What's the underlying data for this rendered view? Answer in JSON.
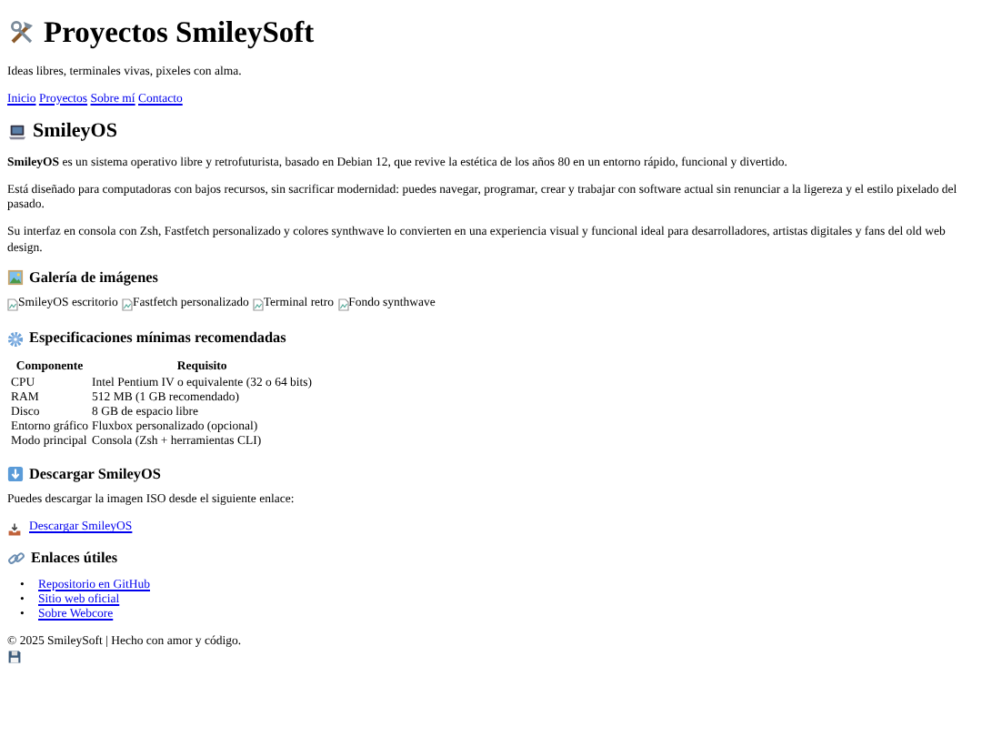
{
  "header": {
    "title": "Proyectos SmileySoft",
    "tagline": "Ideas libres, terminales vivas, pixeles con alma.",
    "nav": [
      "Inicio",
      "Proyectos",
      "Sobre mí",
      "Contacto"
    ]
  },
  "project": {
    "title": "SmileyOS",
    "paragraphs": [
      "**SmileyOS** es un sistema operativo libre y retrofuturista, basado en Debian 12, que revive la estética de los años 80 en un entorno rápido, funcional y divertido.",
      "Está diseñado para computadoras con bajos recursos, sin sacrificar modernidad: puedes navegar, programar, crear y trabajar con software actual sin renunciar a la ligereza y el estilo pixelado del pasado.",
      "Su interfaz en consola con Zsh, Fastfetch personalizado y colores synthwave lo convierten en una experiencia visual y funcional ideal para desarrolladores, artistas digitales y fans del old web design."
    ]
  },
  "gallery": {
    "title": "Galería de imágenes",
    "images": [
      "SmileyOS escritorio",
      "Fastfetch personalizado",
      "Terminal retro",
      "Fondo synthwave"
    ]
  },
  "specs": {
    "title": "Especificaciones mínimas recomendadas",
    "columns": [
      "Componente",
      "Requisito"
    ],
    "rows": [
      [
        "CPU",
        "Intel Pentium IV o equivalente (32 o 64 bits)"
      ],
      [
        "RAM",
        "512 MB (1 GB recomendado)"
      ],
      [
        "Disco",
        "8 GB de espacio libre"
      ],
      [
        "Entorno gráfico",
        "Fluxbox personalizado (opcional)"
      ],
      [
        "Modo principal",
        "Consola (Zsh + herramientas CLI)"
      ]
    ]
  },
  "download": {
    "title": "Descargar SmileyOS",
    "text": "Puedes descargar la imagen ISO desde el siguiente enlace:",
    "link": "Descargar SmileyOS"
  },
  "links": {
    "title": "Enlaces útiles",
    "items": [
      {
        "marker": "•",
        "text": "Repositorio en GitHub"
      },
      {
        "marker": "•",
        "text": "Sitio web oficial"
      },
      {
        "marker": "•",
        "text": "Sobre Webcore"
      }
    ]
  },
  "footer": {
    "text": "© 2025 SmileySoft | Hecho con amor y código."
  }
}
